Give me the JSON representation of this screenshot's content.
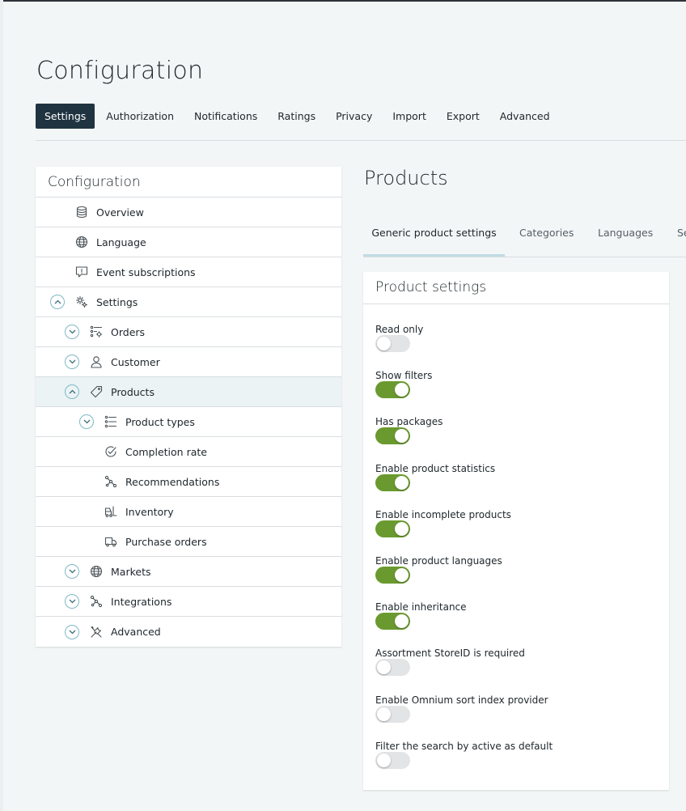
{
  "page": {
    "title": "Configuration"
  },
  "topnav": [
    {
      "label": "Settings",
      "active": true
    },
    {
      "label": "Authorization",
      "active": false
    },
    {
      "label": "Notifications",
      "active": false
    },
    {
      "label": "Ratings",
      "active": false
    },
    {
      "label": "Privacy",
      "active": false
    },
    {
      "label": "Import",
      "active": false
    },
    {
      "label": "Export",
      "active": false
    },
    {
      "label": "Advanced",
      "active": false
    }
  ],
  "sidebar": {
    "title": "Configuration",
    "items": [
      {
        "label": "Overview",
        "icon": "database-icon",
        "level": 0,
        "chevron": "none",
        "selected": false
      },
      {
        "label": "Language",
        "icon": "globe-icon",
        "level": 0,
        "chevron": "none",
        "selected": false
      },
      {
        "label": "Event subscriptions",
        "icon": "chat-icon",
        "level": 0,
        "chevron": "none",
        "selected": false
      },
      {
        "label": "Settings",
        "icon": "gears-icon",
        "level": 0,
        "chevron": "up",
        "selected": false
      },
      {
        "label": "Orders",
        "icon": "list-gear-icon",
        "level": 1,
        "chevron": "down",
        "selected": false
      },
      {
        "label": "Customer",
        "icon": "person-icon",
        "level": 1,
        "chevron": "down",
        "selected": false
      },
      {
        "label": "Products",
        "icon": "tag-icon",
        "level": 1,
        "chevron": "up",
        "selected": true
      },
      {
        "label": "Product types",
        "icon": "list-icon",
        "level": 2,
        "chevron": "down",
        "selected": false
      },
      {
        "label": "Completion rate",
        "icon": "check-circle-icon",
        "level": 3,
        "chevron": "none",
        "selected": false
      },
      {
        "label": "Recommendations",
        "icon": "nodes-icon",
        "level": 3,
        "chevron": "none",
        "selected": false
      },
      {
        "label": "Inventory",
        "icon": "forklift-icon",
        "level": 3,
        "chevron": "none",
        "selected": false
      },
      {
        "label": "Purchase orders",
        "icon": "truck-icon",
        "level": 3,
        "chevron": "none",
        "selected": false
      },
      {
        "label": "Markets",
        "icon": "globe-icon",
        "level": 1,
        "chevron": "down",
        "selected": false
      },
      {
        "label": "Integrations",
        "icon": "nodes-icon",
        "level": 1,
        "chevron": "down",
        "selected": false
      },
      {
        "label": "Advanced",
        "icon": "tools-icon",
        "level": 1,
        "chevron": "down",
        "selected": false
      }
    ]
  },
  "section": {
    "title": "Products"
  },
  "tabs": [
    {
      "label": "Generic product settings",
      "active": true
    },
    {
      "label": "Categories",
      "active": false
    },
    {
      "label": "Languages",
      "active": false
    },
    {
      "label": "Se",
      "active": false
    }
  ],
  "card": {
    "title": "Product settings",
    "settings": [
      {
        "label": "Read only",
        "on": false
      },
      {
        "label": "Show filters",
        "on": true
      },
      {
        "label": "Has packages",
        "on": true
      },
      {
        "label": "Enable product statistics",
        "on": true
      },
      {
        "label": "Enable incomplete products",
        "on": true
      },
      {
        "label": "Enable product languages",
        "on": true
      },
      {
        "label": "Enable inheritance",
        "on": true
      },
      {
        "label": "Assortment StoreID is required",
        "on": false
      },
      {
        "label": "Enable Omnium sort index provider",
        "on": false
      },
      {
        "label": "Filter the search by active as default",
        "on": false
      }
    ]
  },
  "colors": {
    "accent": "#1f3440",
    "toggle_on": "#6a9a2f",
    "toggle_off": "#e2e4e5",
    "selected_row": "#ebf3f5",
    "chevron_border": "#7fb9c6"
  }
}
